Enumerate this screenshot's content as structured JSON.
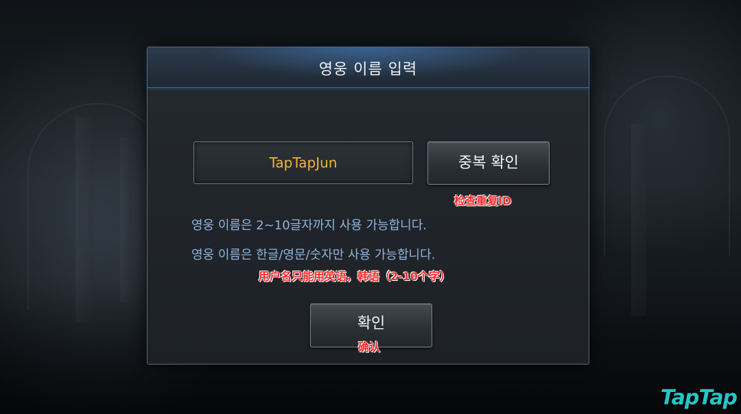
{
  "dialog": {
    "title": "영웅 이름 입력",
    "name_input_value": "TapTapJun",
    "check_button_label": "중복 확인",
    "rules": [
      "영웅 이름은 2~10글자까지 사용 가능합니다.",
      "영웅 이름은 한글/영문/숫자만 사용 가능합니다."
    ],
    "confirm_button_label": "확인"
  },
  "annotations": {
    "check": "检查重复ID",
    "rules": "用户名只能用英语，韩语（2-10个字）",
    "confirm": "确认"
  },
  "watermark": "TapTap",
  "colors": {
    "name_text": "#f0b53c",
    "rule_text": "#8fb4dc",
    "annotation_text": "#ff2a2a",
    "watermark": "#27c4c6",
    "header_glow": "#3d6c99"
  }
}
